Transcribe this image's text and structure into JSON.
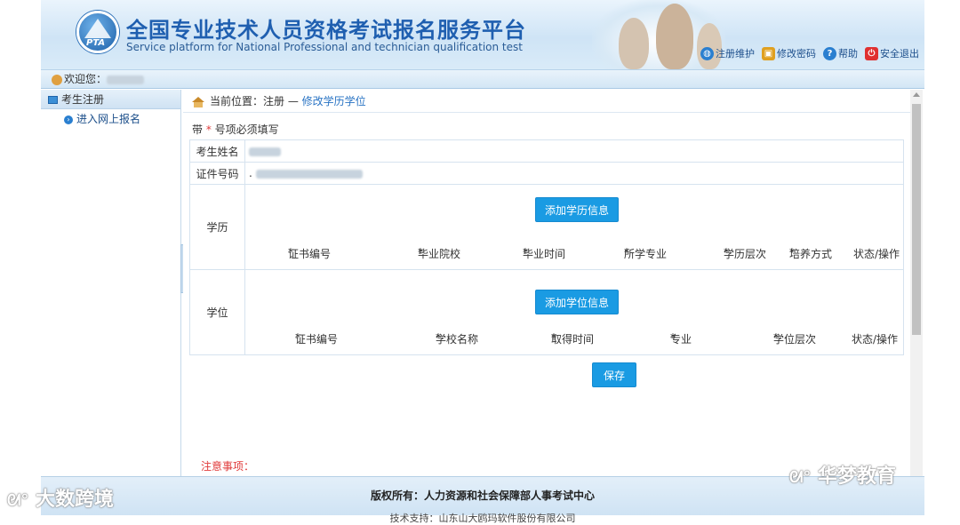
{
  "header": {
    "title_cn": "全国专业技术人员资格考试报名服务平台",
    "title_en": "Service platform for National Professional and technician qualification test",
    "logo_text": "PTA",
    "links": [
      {
        "label": "注册维护",
        "icon": "globe-icon",
        "color": "#2a7fd0"
      },
      {
        "label": "修改密码",
        "icon": "lock-icon",
        "color": "#e0a020"
      },
      {
        "label": "帮助",
        "icon": "help-icon",
        "color": "#2a7fd0"
      },
      {
        "label": "安全退出",
        "icon": "power-icon",
        "color": "#e03030"
      }
    ]
  },
  "welcome": {
    "label": "欢迎您："
  },
  "sidebar": {
    "header": "考生注册",
    "items": [
      {
        "label": "进入网上报名"
      }
    ]
  },
  "breadcrumb": {
    "prefix": "当前位置：注册 — ",
    "current": "修改学历学位"
  },
  "form": {
    "required_note_before": "带",
    "required_star": "*",
    "required_note_after": "号项必须填写",
    "name_label": "考生姓名",
    "id_label": "证件号码",
    "id_prefix": ".",
    "education": {
      "label": "学历",
      "add_button": "添加学历信息",
      "columns": [
        "证书编号",
        "毕业院校",
        "毕业时间",
        "所学专业",
        "学历层次",
        "培养方式"
      ],
      "status_col": "状态/操作"
    },
    "degree": {
      "label": "学位",
      "add_button": "添加学位信息",
      "columns": [
        "证书编号",
        "学校名称",
        "取得时间",
        "专业",
        "学位层次"
      ],
      "status_col": "状态/操作"
    },
    "save_button": "保存",
    "notice": "注意事项："
  },
  "footer": {
    "copyright": "版权所有：人力资源和社会保障部人事考试中心",
    "support": "技术支持：山东山大鸥玛软件股份有限公司"
  },
  "watermarks": {
    "left": "大数跨境",
    "right": "华梦教育"
  },
  "colors": {
    "accent": "#1a9be3",
    "required": "#e03a3a",
    "title": "#1f5fb0"
  }
}
